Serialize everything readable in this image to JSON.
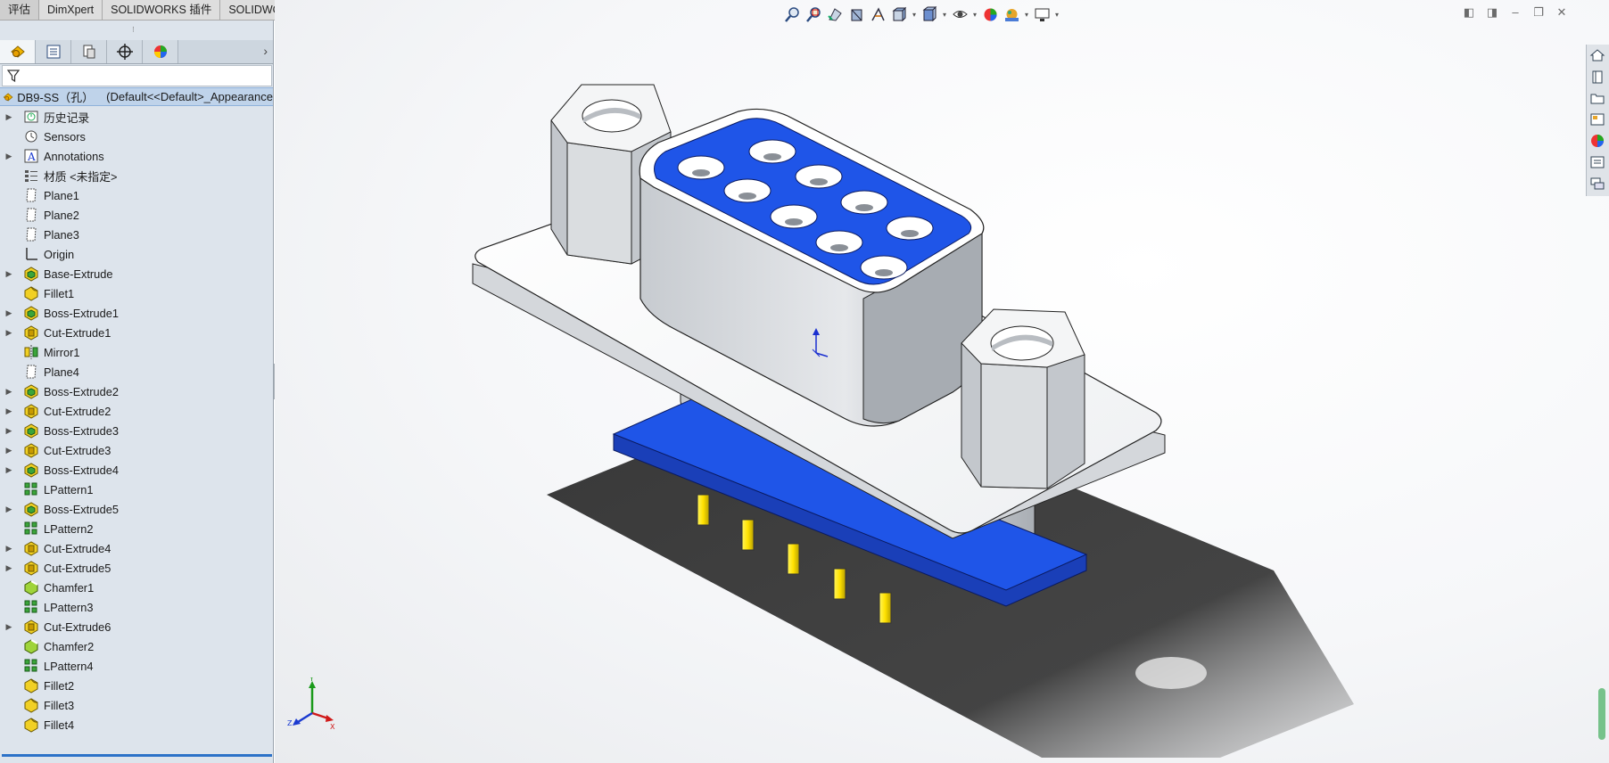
{
  "tabs": [
    {
      "label": "评估"
    },
    {
      "label": "DimXpert"
    },
    {
      "label": "SOLIDWORKS 插件"
    },
    {
      "label": "SOLIDWORKS MBD"
    }
  ],
  "feature_tree": {
    "root": {
      "name": "DB9-SS（孔）",
      "config": "(Default<<Default>_Appearance"
    },
    "items": [
      {
        "label": "历史记录",
        "icon": "history-icon",
        "expandable": true
      },
      {
        "label": "Sensors",
        "icon": "sensor-icon",
        "expandable": false
      },
      {
        "label": "Annotations",
        "icon": "annotation-icon",
        "expandable": true
      },
      {
        "label": "材质 <未指定>",
        "icon": "material-icon",
        "expandable": false
      },
      {
        "label": "Plane1",
        "icon": "plane-icon",
        "expandable": false
      },
      {
        "label": "Plane2",
        "icon": "plane-icon",
        "expandable": false
      },
      {
        "label": "Plane3",
        "icon": "plane-icon",
        "expandable": false
      },
      {
        "label": "Origin",
        "icon": "origin-icon",
        "expandable": false
      },
      {
        "label": "Base-Extrude",
        "icon": "boss-extrude-icon",
        "expandable": true
      },
      {
        "label": "Fillet1",
        "icon": "fillet-icon",
        "expandable": false
      },
      {
        "label": "Boss-Extrude1",
        "icon": "boss-extrude-icon",
        "expandable": true
      },
      {
        "label": "Cut-Extrude1",
        "icon": "cut-extrude-icon",
        "expandable": true
      },
      {
        "label": "Mirror1",
        "icon": "mirror-icon",
        "expandable": false
      },
      {
        "label": "Plane4",
        "icon": "plane-icon",
        "expandable": false
      },
      {
        "label": "Boss-Extrude2",
        "icon": "boss-extrude-icon",
        "expandable": true
      },
      {
        "label": "Cut-Extrude2",
        "icon": "cut-extrude-icon",
        "expandable": true
      },
      {
        "label": "Boss-Extrude3",
        "icon": "boss-extrude-icon",
        "expandable": true
      },
      {
        "label": "Cut-Extrude3",
        "icon": "cut-extrude-icon",
        "expandable": true
      },
      {
        "label": "Boss-Extrude4",
        "icon": "boss-extrude-icon",
        "expandable": true
      },
      {
        "label": "LPattern1",
        "icon": "linear-pattern-icon",
        "expandable": false
      },
      {
        "label": "Boss-Extrude5",
        "icon": "boss-extrude-icon",
        "expandable": true
      },
      {
        "label": "LPattern2",
        "icon": "linear-pattern-icon",
        "expandable": false
      },
      {
        "label": "Cut-Extrude4",
        "icon": "cut-extrude-icon",
        "expandable": true
      },
      {
        "label": "Cut-Extrude5",
        "icon": "cut-extrude-icon",
        "expandable": true
      },
      {
        "label": "Chamfer1",
        "icon": "chamfer-icon",
        "expandable": false
      },
      {
        "label": "LPattern3",
        "icon": "linear-pattern-icon",
        "expandable": false
      },
      {
        "label": "Cut-Extrude6",
        "icon": "cut-extrude-icon",
        "expandable": true
      },
      {
        "label": "Chamfer2",
        "icon": "chamfer-icon",
        "expandable": false
      },
      {
        "label": "LPattern4",
        "icon": "linear-pattern-icon",
        "expandable": false
      },
      {
        "label": "Fillet2",
        "icon": "fillet-icon",
        "expandable": false
      },
      {
        "label": "Fillet3",
        "icon": "fillet-icon",
        "expandable": false
      },
      {
        "label": "Fillet4",
        "icon": "fillet-icon",
        "expandable": false
      }
    ]
  },
  "panel_tabs": [
    "feature-manager-icon",
    "property-manager-icon",
    "configuration-manager-icon",
    "dimxpert-manager-icon",
    "display-manager-icon"
  ],
  "hud_tools": [
    "zoom-to-fit-icon",
    "zoom-to-area-icon",
    "previous-view-icon",
    "section-view-icon",
    "dynamic-annotation-icon",
    "view-orientation-icon",
    "display-style-icon",
    "hide-show-icon",
    "edit-appearance-icon",
    "apply-scene-icon",
    "view-settings-icon"
  ],
  "task_pane": [
    "home-icon",
    "design-library-icon",
    "file-explorer-icon",
    "view-palette-icon",
    "appearances-icon",
    "custom-properties-icon",
    "forum-icon"
  ],
  "colors": {
    "panel_bg": "#dde4ec",
    "selection": "#bfd3ea",
    "model_body": "#e3e6e9",
    "model_insert": "#1a55e6",
    "pins": "#ffe100",
    "shadow": "#3a3a3a"
  }
}
